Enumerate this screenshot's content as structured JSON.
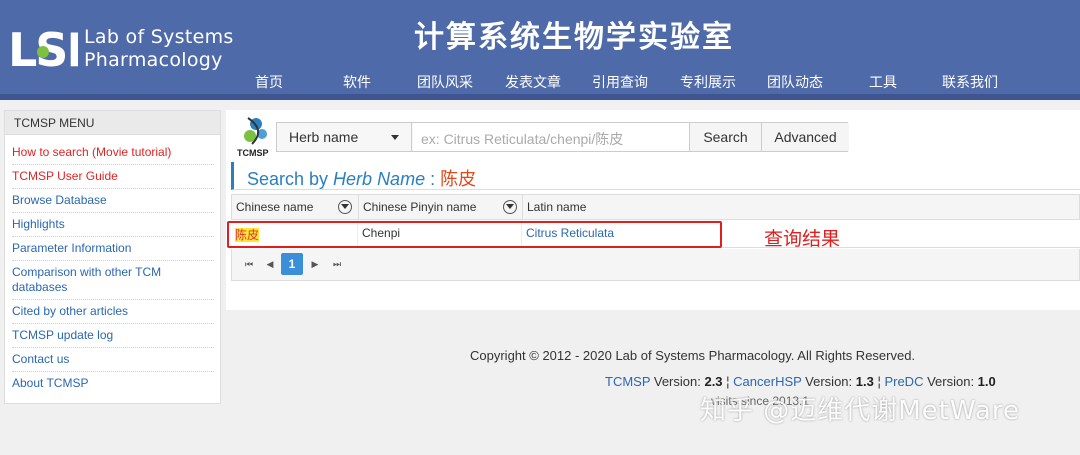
{
  "header": {
    "logo_text": "LSP",
    "lab_line1": "Lab of Systems",
    "lab_line2": "Pharmacology",
    "site_title": "计算系统生物学实验室",
    "nav": [
      "首页",
      "软件",
      "团队风采",
      "发表文章",
      "引用查询",
      "专利展示",
      "团队动态",
      "工具",
      "联系我们"
    ]
  },
  "sidebar": {
    "title": "TCMSP MENU",
    "items": [
      {
        "label": "How to search (Movie tutorial)",
        "color": "red"
      },
      {
        "label": "TCMSP User Guide",
        "color": "red"
      },
      {
        "label": "Browse Database",
        "color": "blue"
      },
      {
        "label": "Highlights",
        "color": "blue"
      },
      {
        "label": "Parameter Information",
        "color": "blue"
      },
      {
        "label": "Comparison with other TCM databases",
        "color": "blue"
      },
      {
        "label": "Cited by other articles",
        "color": "blue"
      },
      {
        "label": "TCMSP update log",
        "color": "blue"
      },
      {
        "label": "Contact us",
        "color": "blue"
      },
      {
        "label": "About TCMSP",
        "color": "blue"
      }
    ]
  },
  "search": {
    "logo_text": "TCMSP",
    "type_selected": "Herb name",
    "placeholder": "ex: Citrus Reticulata/chenpi/陈皮",
    "search_label": "Search",
    "advanced_label": "Advanced",
    "heading_prefix": "Search by ",
    "heading_field": "Herb Name",
    "heading_sep": " : ",
    "heading_value": "陈皮"
  },
  "grid": {
    "columns": [
      "Chinese name",
      "Chinese Pinyin name",
      "Latin name"
    ],
    "rows": [
      {
        "chinese": "陈皮",
        "pinyin": "Chenpi",
        "latin": "Citrus Reticulata"
      }
    ]
  },
  "pager": {
    "current": "1",
    "first": "⏮",
    "prev": "◀",
    "next": "▶",
    "last": "⏭"
  },
  "annotation": {
    "result_label": "查询结果"
  },
  "footer": {
    "copyright": "Copyright © 2012 - 2020 Lab of Systems Pharmacology. All Rights Reserved.",
    "v1_name": "TCMSP",
    "v1_label": " Version: ",
    "v1": "2.3",
    "v2_name": "CancerHSP",
    "v2_label": " Version: ",
    "v2": "1.3",
    "v3_name": "PreDC",
    "v3_label": " Version: ",
    "v3": "1.0",
    "sep": " ¦ ",
    "since": "visits since 2013.1"
  },
  "watermark": "知乎 @迈维代谢MetWare",
  "colors": {
    "header_bg": "#4f6aa8",
    "accent_blue": "#2a7fc0",
    "link_blue": "#2a67b1",
    "alert_red": "#e01e1e",
    "highlight_yellow": "#ffe830"
  }
}
